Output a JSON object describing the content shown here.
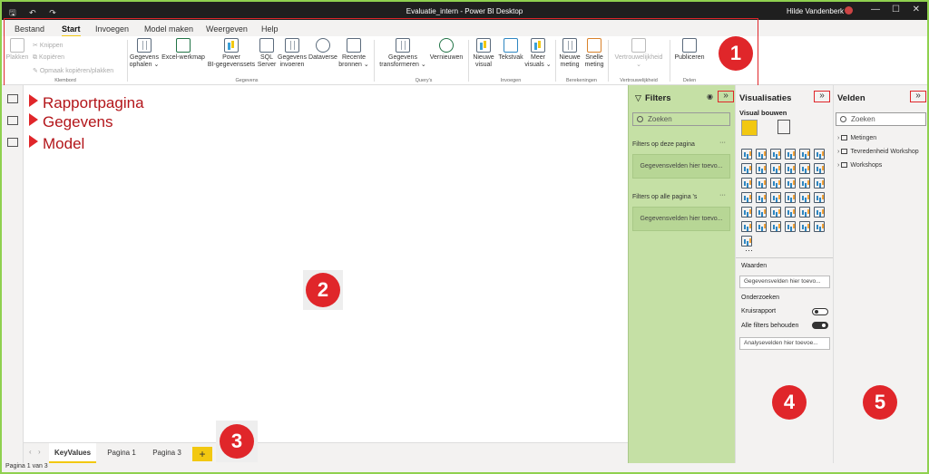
{
  "titlebar": {
    "quick_access": "🖫 ↶ ↷",
    "title": "Evaluatie_intern - Power BI Desktop",
    "user": "Hilde Vandenberk",
    "minimize": "—",
    "restore": "☐",
    "close": "✕"
  },
  "menu": {
    "tabs": [
      "Bestand",
      "Start",
      "Invoegen",
      "Model maken",
      "Weergeven",
      "Help"
    ],
    "active": "Start"
  },
  "ribbon": {
    "klembord": {
      "group": "Klembord",
      "plakken": "Plakken",
      "knippen": "Knippen",
      "kopieren": "Kopiëren",
      "opmaak": "Opmaak kopiëren/plakken"
    },
    "gegevens": {
      "group": "Gegevens",
      "buttons": [
        {
          "l1": "Gegevens",
          "l2": "ophalen ⌄"
        },
        {
          "l1": "Excel-werkmap",
          "l2": ""
        },
        {
          "l1": "Power",
          "l2": "BI-gegevenssets"
        },
        {
          "l1": "SQL",
          "l2": "Server"
        },
        {
          "l1": "Gegevens",
          "l2": "invoeren"
        },
        {
          "l1": "Dataverse",
          "l2": ""
        },
        {
          "l1": "Recente",
          "l2": "bronnen ⌄"
        }
      ]
    },
    "querys": {
      "group": "Query's",
      "buttons": [
        {
          "l1": "Gegevens",
          "l2": "transformeren ⌄"
        },
        {
          "l1": "Vernieuwen",
          "l2": ""
        }
      ]
    },
    "invoegen": {
      "group": "Invoegen",
      "buttons": [
        {
          "l1": "Nieuwe",
          "l2": "visual"
        },
        {
          "l1": "Tekstvak",
          "l2": ""
        },
        {
          "l1": "Meer",
          "l2": "visuals ⌄"
        }
      ]
    },
    "berekeningen": {
      "group": "Berekeningen",
      "buttons": [
        {
          "l1": "Nieuwe",
          "l2": "meting"
        },
        {
          "l1": "Snelle",
          "l2": "meting"
        }
      ]
    },
    "vertrouwelijkheid": {
      "group": "Vertrouwelijkheid",
      "button": {
        "l1": "Vertrouwelijkheid",
        "l2": "⌄"
      }
    },
    "delen": {
      "group": "Delen",
      "button": {
        "l1": "Publiceren",
        "l2": ""
      }
    }
  },
  "annotations": {
    "rapportpagina": "Rapportpagina",
    "gegevens": "Gegevens",
    "model": "Model",
    "badges": [
      "1",
      "2",
      "3",
      "4",
      "5"
    ]
  },
  "pages": {
    "tabs": [
      "KeyValues",
      "Pagina 1",
      "Pagina 3"
    ],
    "active": "KeyValues",
    "add": "+",
    "prev": "‹",
    "next": "›"
  },
  "status": "Pagina 1 van 3",
  "filters": {
    "title": "Filters",
    "search_placeholder": "Zoeken",
    "section_page": "Filters op deze pagina",
    "section_all": "Filters op alle pagina 's",
    "well": "Gegevensvelden hier toevo...",
    "more": "···",
    "collapse": "»"
  },
  "visualisaties": {
    "title": "Visualisaties",
    "subtitle": "Visual bouwen",
    "waarden": "Waarden",
    "waarden_field": "Gegevensvelden hier toevo...",
    "onderzoeken": "Onderzoeken",
    "kruisrapport": "Kruisrapport",
    "alle_filters": "Alle filters behouden",
    "analyse_field": "Analysevelden hier toevoe...",
    "icon_count": 37,
    "more": "···",
    "collapse": "»"
  },
  "velden": {
    "title": "Velden",
    "search_placeholder": "Zoeken",
    "items": [
      "Metingen",
      "Tevredenheid Workshop",
      "Workshops"
    ],
    "collapse": "»"
  }
}
